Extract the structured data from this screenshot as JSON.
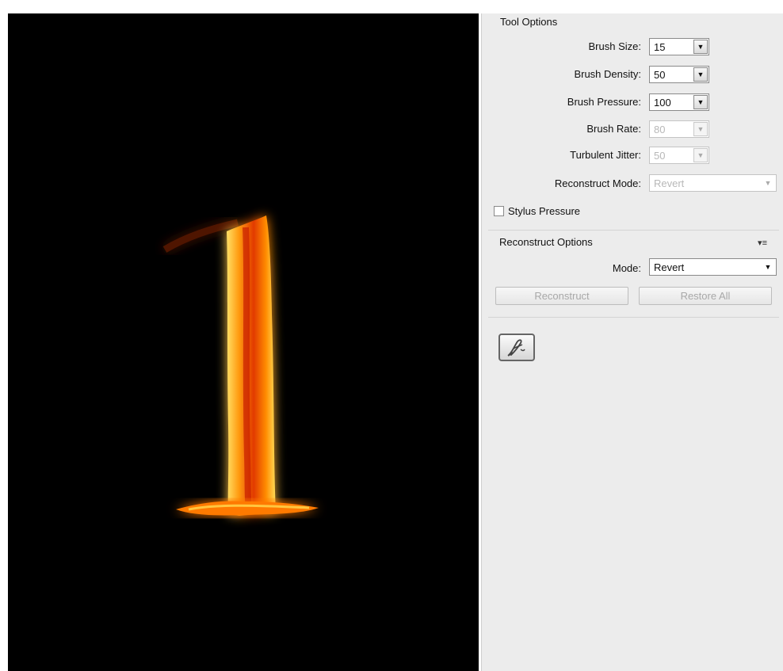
{
  "tool_options": {
    "title": "Tool Options",
    "fields": [
      {
        "label": "Brush Size:",
        "value": "15",
        "enabled": true
      },
      {
        "label": "Brush Density:",
        "value": "50",
        "enabled": true
      },
      {
        "label": "Brush Pressure:",
        "value": "100",
        "enabled": true
      },
      {
        "label": "Brush Rate:",
        "value": "80",
        "enabled": false
      },
      {
        "label": "Turbulent Jitter:",
        "value": "50",
        "enabled": false
      }
    ],
    "reconstruct_mode": {
      "label": "Reconstruct Mode:",
      "value": "Revert",
      "enabled": false
    },
    "stylus_pressure": {
      "label": "Stylus Pressure",
      "checked": false
    }
  },
  "reconstruct_options": {
    "title": "Reconstruct Options",
    "mode": {
      "label": "Mode:",
      "value": "Revert"
    },
    "reconstruct_label": "Reconstruct",
    "restore_all_label": "Restore All"
  },
  "icons": {
    "dropdown": "▼",
    "panel_menu": "▾≡",
    "tool": "liquify-brush-icon"
  },
  "colors": {
    "canvas_background": "#000000",
    "panel_background": "#ececec",
    "flame_core": "#ff8a00",
    "flame_edge": "#ffd24a"
  }
}
